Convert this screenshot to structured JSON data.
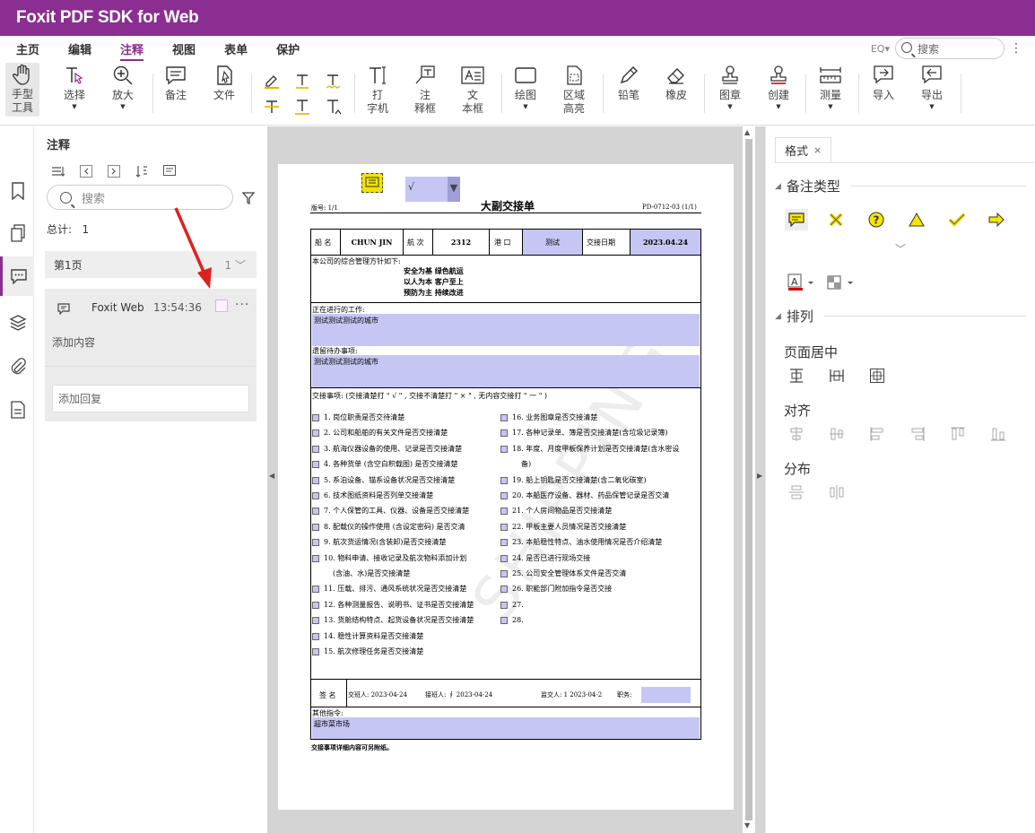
{
  "app": {
    "title": "Foxit PDF SDK for Web",
    "brand_color": "#8a2e91"
  },
  "menu": {
    "items": [
      "主页",
      "编辑",
      "注释",
      "视图",
      "表单",
      "保护"
    ],
    "active": "注释",
    "search_placeholder": "搜索",
    "eq_label": "EQ▾"
  },
  "toolbar": {
    "hand": [
      "手型",
      "工具"
    ],
    "select": "选择",
    "zoom": "放大",
    "note": "备注",
    "file": "文件",
    "typewriter": [
      "打",
      "字机"
    ],
    "callout": [
      "注",
      "释框"
    ],
    "textbox": [
      "文",
      "本框"
    ],
    "draw": "绘图",
    "area": [
      "区域",
      "高亮"
    ],
    "pencil": "铅笔",
    "eraser": "橡皮",
    "stamp": "图章",
    "create": "创建",
    "measure": "测量",
    "import": "导入",
    "export": "导出"
  },
  "sidepanel": {
    "title": "注释",
    "search_placeholder": "搜索",
    "total_label": "总计:",
    "total": "1",
    "page_label": "第1页",
    "page_count": "1",
    "card": {
      "author": "Foxit Web",
      "time": "13:54:36",
      "content": "添加内容",
      "reply_placeholder": "添加回复"
    }
  },
  "pdf": {
    "check_mark": "√",
    "title": "大副交接单",
    "edition": "版号: 1/1",
    "doc_no": "PD-0712-03  (1/1)",
    "ship_label": "船 名",
    "ship": "CHUN JIN",
    "voyage_label": "航 次",
    "voyage": "2312",
    "port_label": "港 口",
    "port": "测试",
    "date_label": "交接日期",
    "date": "2023.04.24",
    "policy_label": "本公司的综合管理方针如下:",
    "policy_lines": [
      "安全为基   绿色航运",
      "以人为本   客户至上",
      "预防为主   持续改进"
    ],
    "work_label": "正在进行的工作:",
    "work_value": "测试测试测试的城市",
    "pending_label": "遗留待办事项:",
    "pending_value": "测试测试测试的城市",
    "handover_instr": "交接事项: (交接清楚打 \" √ \" , 交接不清楚打 \" × \" , 无内容交接打 \" 一 \" )",
    "left_items": [
      "1. 岗位职责是否交待清楚",
      "2. 公司和船舶的有关文件是否交接清楚",
      "3. 航海仪器设备的使用、记录是否交接清楚",
      "4. 各种货单 (含空白积载图) 是否交接清楚",
      "5. 系泊设备、锚系设备状况是否交接清楚",
      "6. 技术图纸资料是否列单交接清楚",
      "7. 个人保管的工具、仪器、设备是否交接清楚",
      "8. 配载仪的操作使用 (含设定密码) 是否交清",
      "9. 航次货运情况(含装卸)是否交接清楚",
      "10. 物料申请、接收记录及航次物料添加计划",
      "(含油、水)是否交接清楚",
      "11. 压载、排污、通风系统状况是否交接清楚",
      "12. 各种测量报告、说明书、证书是否交接清楚",
      "13. 货舱结构特点、起货设备状况是否交接清楚",
      "14. 稳性计算资料是否交接清楚",
      "15. 航次修理任务是否交接清楚"
    ],
    "right_items": [
      "16. 业务图章是否交接清楚",
      "17. 各种记录单、簿是否交接清楚(含垃圾记录簿)",
      "18. 年度、月度甲板保养计划是否交接清楚(含水密设",
      "备)",
      "19. 船上钥匙是否交接清楚(含二氧化碳室)",
      "20. 本船医疗设备、器材、药品保管记录是否交清",
      "21. 个人房间物品是否交接清楚",
      "22. 甲板主要人员情况是否交接清楚",
      "23. 本船稳性特点、油水使用情况是否介绍清楚",
      "24. 是否已进行现场交接",
      "25. 公司安全管理体系文件是否交清",
      "26. 职能部门附加指令是否交接",
      "27.",
      "28."
    ],
    "sign_label": "签 名",
    "handover_by": "交班人:  2023-04-24",
    "takeover_by": "接班人: ∮ 2023-04-24",
    "supervisor": "监交人: 1  2023-04-2",
    "position": "职务:",
    "other_label": "其他指令:",
    "other_value": "超市菜市场",
    "footnote": "交接事项详细内容可另附纸。",
    "watermark": "SHIPPING"
  },
  "rightpanel": {
    "tab": "格式",
    "tab_close": "×",
    "note_type_label": "备注类型",
    "arrange_label": "排列",
    "page_center_label": "页面居中",
    "align_label": "对齐",
    "distribute_label": "分布",
    "note_icon_color": "#c8b400",
    "font_color": "#d00000"
  }
}
